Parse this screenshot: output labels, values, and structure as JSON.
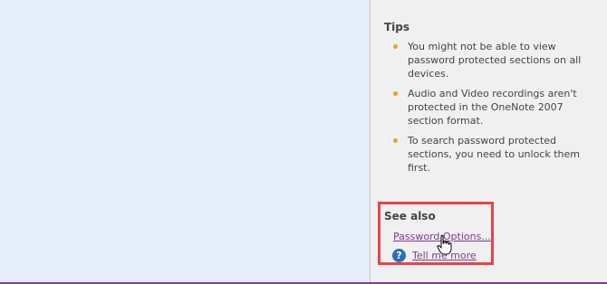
{
  "tips": {
    "heading": "Tips",
    "items": [
      "You might not be able to view password protected sections on all devices.",
      "Audio and Video recordings aren't protected in the OneNote 2007 section format.",
      "To search password protected sections, you need to unlock them first."
    ]
  },
  "see_also": {
    "heading": "See also",
    "links": [
      "Password Options...",
      "Tell me more"
    ],
    "help_icon_glyph": "?"
  },
  "colors": {
    "bullet": "#e8a32e",
    "link": "#7b3d8e",
    "highlight_box": "#e8434b",
    "help_icon": "#2b6fb6"
  }
}
